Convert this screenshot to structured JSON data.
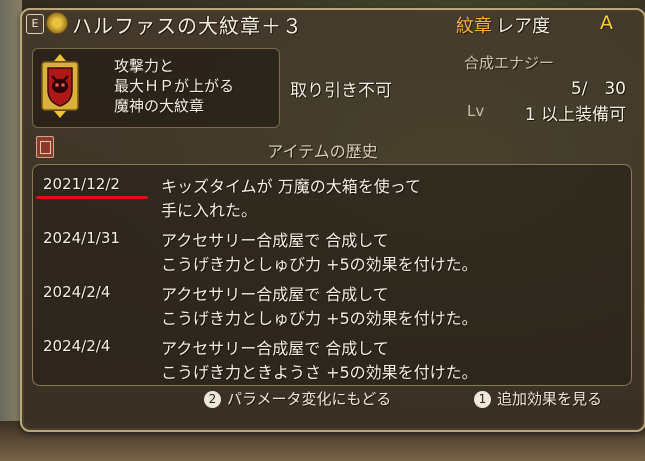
{
  "item": {
    "e_marker": "E",
    "name": "ハルファスの大紋章＋３",
    "rarity_label": "紋章",
    "rarity_sub": "レア度",
    "rarity_grade": "A",
    "description": [
      "攻撃力と",
      "最大ＨＰが上がる",
      "魔神の大紋章"
    ],
    "trade": "取り引き不可",
    "energy_label": "合成エナジー",
    "energy_value": "5/　30",
    "level_label": "Lv",
    "level_value": "1 以上装備可"
  },
  "history": {
    "heading": "アイテムの歴史",
    "entries": [
      {
        "date": "2021/12/2",
        "line1": "キッズタイムが 万魔の大箱を使って",
        "line2": "手に入れた。"
      },
      {
        "date": "2024/1/31",
        "line1": "アクセサリー合成屋で 合成して",
        "line2": "こうげき力としゅび力 +5の効果を付けた。"
      },
      {
        "date": "2024/2/4",
        "line1": "アクセサリー合成屋で 合成して",
        "line2": "こうげき力としゅび力 +5の効果を付けた。"
      },
      {
        "date": "2024/2/4",
        "line1": "アクセサリー合成屋で 合成して",
        "line2": "こうげき力ときようさ +5の効果を付けた。"
      }
    ]
  },
  "footer": {
    "param_button_num": "2",
    "param_label": "パラメータ変化にもどる",
    "effect_button_num": "1",
    "effect_label": "追加効果を見る"
  },
  "colors": {
    "rarity": "#f4b23a",
    "highlight_underline": "#e0101a"
  }
}
